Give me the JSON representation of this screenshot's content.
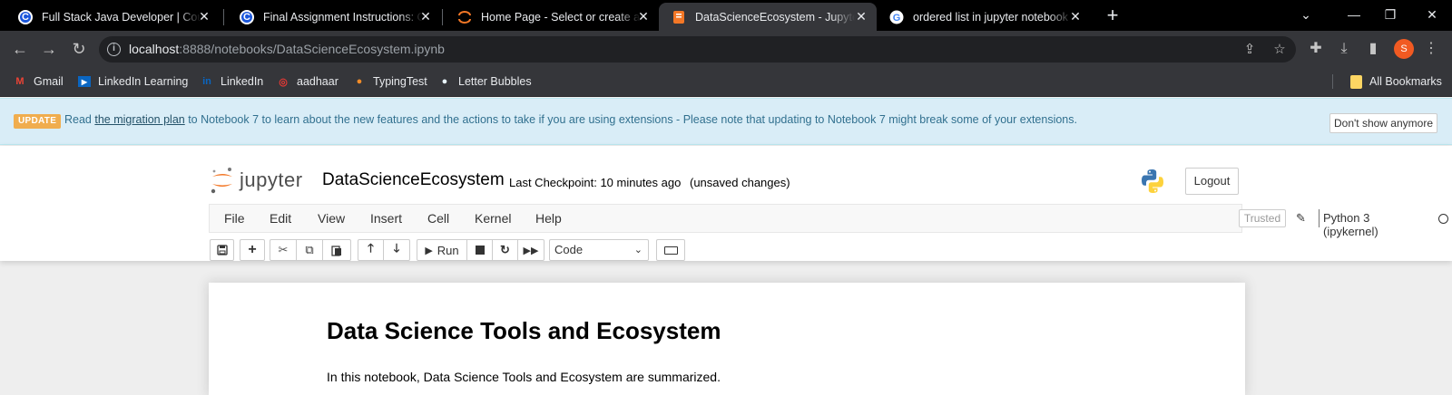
{
  "browser": {
    "tabs": [
      {
        "title": "Full Stack Java Developer | Course",
        "icon": "coursera-c-icon",
        "active": false
      },
      {
        "title": "Final Assignment Instructions: Cr",
        "icon": "coursera-c-icon",
        "active": false
      },
      {
        "title": "Home Page - Select or create a n",
        "icon": "jupyter-icon",
        "active": false
      },
      {
        "title": "DataScienceEcosystem - Jupyter",
        "icon": "notebook-icon",
        "active": true
      },
      {
        "title": "ordered list in jupyter notebook",
        "icon": "google-icon",
        "active": false
      }
    ],
    "url_host": "localhost",
    "url_rest": ":8888/notebooks/DataScienceEcosystem.ipynb",
    "profile_initial": "S",
    "bookmarks": [
      {
        "label": "Gmail",
        "icon": "gmail-icon"
      },
      {
        "label": "LinkedIn Learning",
        "icon": "linkedin-learning-icon"
      },
      {
        "label": "LinkedIn",
        "icon": "linkedin-icon"
      },
      {
        "label": "aadhaar",
        "icon": "aadhaar-icon"
      },
      {
        "label": "TypingTest",
        "icon": "typingtest-icon"
      },
      {
        "label": "Letter Bubbles",
        "icon": "letter-bubbles-icon"
      }
    ],
    "all_bookmarks_label": "All Bookmarks"
  },
  "banner": {
    "badge": "UPDATE",
    "text_before": "Read ",
    "link": "the migration plan",
    "text_after": " to Notebook 7 to learn about the new features and the actions to take if you are using extensions - Please note that updating to Notebook 7 might break some of your extensions.",
    "dismiss_label": "Don't show anymore"
  },
  "jupyter": {
    "logo_text": "jupyter",
    "notebook_name": "DataScienceEcosystem",
    "checkpoint": "Last Checkpoint: 10 minutes ago",
    "unsaved": "(unsaved changes)",
    "logout_label": "Logout",
    "menu": [
      "File",
      "Edit",
      "View",
      "Insert",
      "Cell",
      "Kernel",
      "Help"
    ],
    "trusted_label": "Trusted",
    "kernel_name": "Python 3 (ipykernel)",
    "run_label": "Run",
    "cell_type": "Code"
  },
  "notebook": {
    "heading": "Data Science Tools and Ecosystem",
    "paragraph": "In this notebook, Data Science Tools and Ecosystem are summarized."
  },
  "colors": {
    "tab_bar": "#000000",
    "toolbar": "#35363a",
    "banner_bg": "#d9edf7",
    "badge": "#f0ad4e",
    "jupyter_orange": "#f37726"
  }
}
